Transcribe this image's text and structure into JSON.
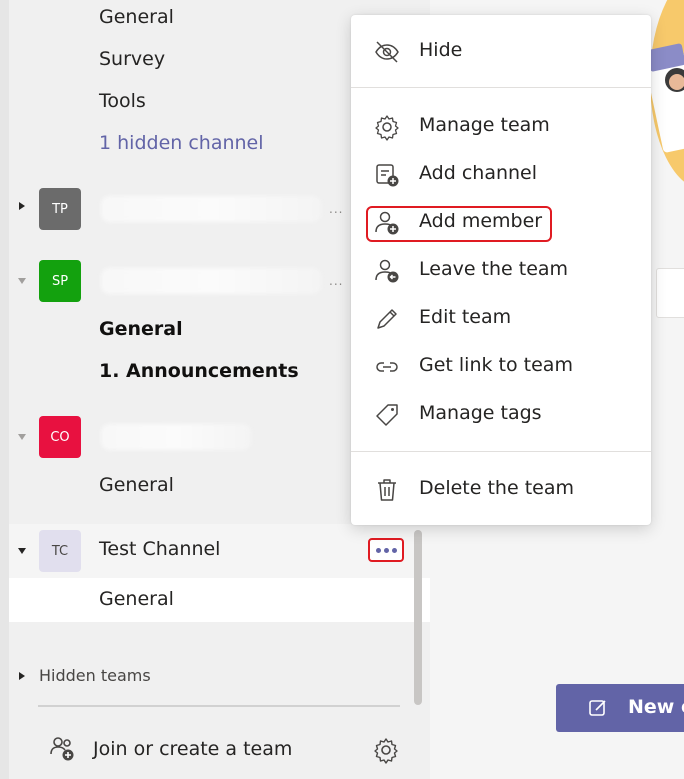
{
  "sidebar": {
    "top_channels": [
      "General",
      "Survey",
      "Tools"
    ],
    "hidden_channel_link": "1 hidden channel",
    "teams": [
      {
        "initials": "TP",
        "color": "#6b6b6b"
      },
      {
        "initials": "SP",
        "color": "#13a10e",
        "channels": [
          "General",
          "1. Announcements"
        ]
      },
      {
        "initials": "CO",
        "color": "#e81140",
        "channels": [
          "General"
        ]
      },
      {
        "initials": "TC",
        "color": "#e1dfee",
        "text_color": "#484644",
        "name": "Test Channel",
        "channels": [
          "General"
        ]
      }
    ],
    "hidden_teams_label": "Hidden teams",
    "join_create_label": "Join or create a team"
  },
  "context_menu": {
    "items": [
      {
        "label": "Hide",
        "icon": "hide-icon"
      },
      {
        "label": "Manage team",
        "icon": "gear-icon"
      },
      {
        "label": "Add channel",
        "icon": "add-channel-icon"
      },
      {
        "label": "Add member",
        "icon": "add-member-icon",
        "highlighted": true
      },
      {
        "label": "Leave the team",
        "icon": "leave-team-icon"
      },
      {
        "label": "Edit team",
        "icon": "pencil-icon"
      },
      {
        "label": "Get link to team",
        "icon": "link-icon"
      },
      {
        "label": "Manage tags",
        "icon": "tag-icon"
      },
      {
        "label": "Delete the team",
        "icon": "trash-icon"
      }
    ]
  },
  "main": {
    "new_button_label": "New c"
  },
  "colors": {
    "accent": "#6264a7",
    "highlight": "#e01b22"
  }
}
